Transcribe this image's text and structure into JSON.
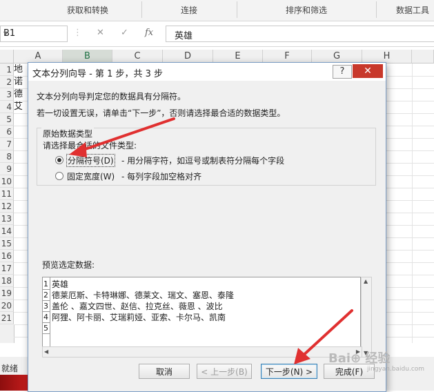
{
  "ribbon": {
    "groups": [
      "获取和转换",
      "连接",
      "排序和筛选",
      "数据工具"
    ]
  },
  "formula_bar": {
    "name_box": "B1",
    "formula": "英雄",
    "icons": [
      "cancel-icon",
      "enter-icon",
      "function-icon"
    ],
    "fx_label": "fx"
  },
  "grid": {
    "columns": [
      "A",
      "B",
      "C",
      "D",
      "E",
      "F",
      "G",
      "H"
    ],
    "rows": [
      "1",
      "2",
      "3",
      "4",
      "5",
      "6",
      "7",
      "8",
      "9",
      "10",
      "11",
      "12",
      "13",
      "14",
      "15",
      "16",
      "17",
      "18",
      "19",
      "20",
      "21"
    ],
    "col_a_visible": [
      "地",
      "诺",
      "德",
      "艾"
    ]
  },
  "status": {
    "text": "就绪"
  },
  "dialog": {
    "title": "文本分列向导 - 第 1 步，共 3 步",
    "help": "?",
    "close": "✕",
    "intro_1": "文本分列向导判定您的数据具有分隔符。",
    "intro_2": "若一切设置无误，请单击“下一步”，否则请选择最合适的数据类型。",
    "group_title": "原始数据类型",
    "group_prompt": "请选择最合适的文件类型:",
    "options": [
      {
        "label": "分隔符号(D)",
        "desc": "- 用分隔字符，如逗号或制表符分隔每个字段",
        "selected": true
      },
      {
        "label": "固定宽度(W)",
        "desc": "- 每列字段加空格对齐",
        "selected": false
      }
    ],
    "preview_label": "预览选定数据:",
    "preview_rows": [
      {
        "n": "1",
        "text": "英雄"
      },
      {
        "n": "2",
        "text": "德莱厄斯、卡特琳娜、德莱文、瑞文、塞恩、泰隆"
      },
      {
        "n": "3",
        "text": "盖伦  、嘉文四世、赵信、拉克丝、薇恩  、波比"
      },
      {
        "n": "4",
        "text": "阿狸、阿卡丽、艾瑞莉娅、亚索、卡尔马、凯南"
      },
      {
        "n": "5",
        "text": ""
      }
    ],
    "buttons": {
      "cancel": "取消",
      "back": "< 上一步(B)",
      "next": "下一步(N) >",
      "finish": "完成(F)"
    }
  },
  "watermark": {
    "text": "Bai⊕ 经验",
    "url": "jingyan.baidu.com"
  },
  "colors": {
    "excel_green": "#217346",
    "annotation_red": "#e03030",
    "close_red": "#c8382b"
  }
}
